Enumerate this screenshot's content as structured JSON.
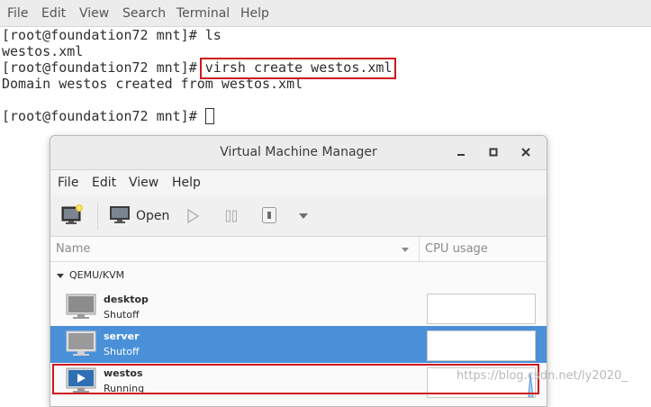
{
  "terminal": {
    "menu": [
      "File",
      "Edit",
      "View",
      "Search",
      "Terminal",
      "Help"
    ],
    "lines": [
      "[root@foundation72 mnt]# ls",
      "westos.xml",
      "[root@foundation72 mnt]# ",
      "Domain westos created from westos.xml",
      "",
      "[root@foundation72 mnt]# "
    ],
    "highlighted_command": "virsh create westos.xml"
  },
  "vmm": {
    "title": "Virtual Machine Manager",
    "menu": [
      "File",
      "Edit",
      "View",
      "Help"
    ],
    "toolbar": {
      "open_label": "Open"
    },
    "columns": {
      "name": "Name",
      "cpu": "CPU usage"
    },
    "group": "QEMU/KVM",
    "vms": [
      {
        "name": "desktop",
        "status": "Shutoff"
      },
      {
        "name": "server",
        "status": "Shutoff"
      },
      {
        "name": "westos",
        "status": "Running"
      }
    ],
    "selected_index": 1
  },
  "watermark": "https://blog.csdn.net/ly2020_",
  "colors": {
    "highlight": "#d0161e",
    "selection": "#4a90d9"
  }
}
